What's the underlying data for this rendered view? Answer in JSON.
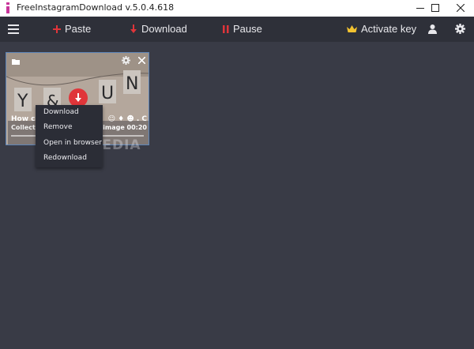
{
  "window": {
    "title": "FreeInstagramDownload  v.5.0.4.618",
    "controls": [
      "minimize-icon",
      "maximize-icon",
      "close-icon"
    ]
  },
  "toolbar": {
    "menu_icon": "hamburger-icon",
    "paste_label": "Paste",
    "download_label": "Download",
    "pause_label": "Pause",
    "activate_label": "Activate key",
    "icons": [
      "plus-icon",
      "arrow-down-icon",
      "pause-icon",
      "crown-icon",
      "user-icon",
      "gear-icon"
    ]
  },
  "card": {
    "title": "How c",
    "subtitle": "Collecti",
    "meta_right": "☺ ♦ ☻ . C",
    "meta_right2": "image 00:20",
    "icons": [
      "folder-icon",
      "gear-icon",
      "close-icon",
      "download-icon"
    ]
  },
  "context_menu": {
    "items": [
      "Download",
      "Remove",
      "Open in browser",
      "Redownload"
    ]
  },
  "watermark": "SOFTPEDIA",
  "colors": {
    "background": "#393b46",
    "toolbar": "#2e3039",
    "accent_red": "#e0353a",
    "crown_gold": "#f2c230",
    "selection_border": "#5e86b9"
  }
}
